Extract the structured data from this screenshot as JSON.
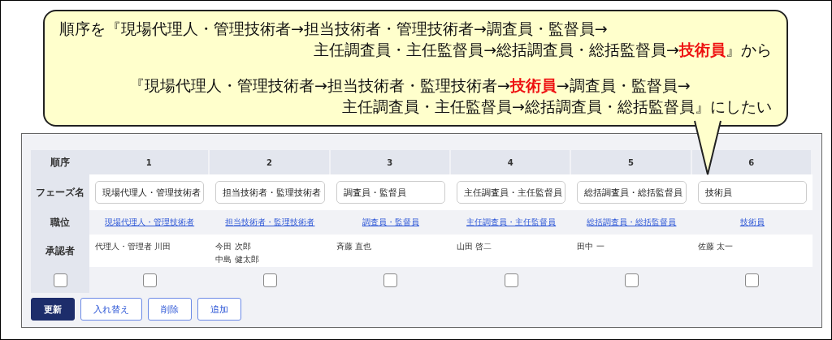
{
  "callout": {
    "paragraphs": [
      {
        "lines": [
          [
            {
              "text": "順序を『現場代理人・管理技術者→担当技術者・管理技術者→調査員・監督員→",
              "highlight": false
            }
          ],
          [
            {
              "text": "主任調査員・主任監督員→総括調査員・総括監督員→",
              "highlight": false
            },
            {
              "text": "技術員",
              "highlight": true
            },
            {
              "text": "』から",
              "highlight": false
            }
          ]
        ]
      },
      {
        "lines": [
          [
            {
              "text": "『現場代理人・管理技術者→担当技術者・監理技術者→",
              "highlight": false
            },
            {
              "text": "技術員",
              "highlight": true
            },
            {
              "text": "→調査員・監督員→",
              "highlight": false
            }
          ],
          [
            {
              "text": "主任調査員・主任監督員→総括調査員・総括監督員』にしたい",
              "highlight": false
            }
          ]
        ]
      }
    ]
  },
  "table": {
    "row_headers": [
      "順序",
      "フェーズ名",
      "職位",
      "承認者"
    ],
    "select_all": {
      "checked": false
    },
    "columns": [
      {
        "order": "1",
        "phase_name": "現場代理人・管理技術者",
        "role": "現場代理人・管理技術者",
        "approvers": [
          "代理人・管理者 川田"
        ],
        "checked": false
      },
      {
        "order": "2",
        "phase_name": "担当技術者・監理技術者",
        "role": "担当技術者・監理技術者",
        "approvers": [
          "今田 次郎",
          "中島 健太郎"
        ],
        "checked": false
      },
      {
        "order": "3",
        "phase_name": "調査員・監督員",
        "role": "調査員・監督員",
        "approvers": [
          "斉藤 直也"
        ],
        "checked": false
      },
      {
        "order": "4",
        "phase_name": "主任調査員・主任監督員",
        "role": "主任調査員・主任監督員",
        "approvers": [
          "山田 啓二"
        ],
        "checked": false
      },
      {
        "order": "5",
        "phase_name": "総括調査員・総括監督員",
        "role": "総括調査員・総括監督員",
        "approvers": [
          "田中 一"
        ],
        "checked": false
      },
      {
        "order": "6",
        "phase_name": "技術員",
        "role": "技術員",
        "approvers": [
          "佐藤 太一"
        ],
        "checked": false
      }
    ]
  },
  "buttons": [
    {
      "label": "更新",
      "kind": "primary"
    },
    {
      "label": "入れ替え",
      "kind": "secondary"
    },
    {
      "label": "削除",
      "kind": "secondary"
    },
    {
      "label": "追加",
      "kind": "secondary"
    }
  ]
}
